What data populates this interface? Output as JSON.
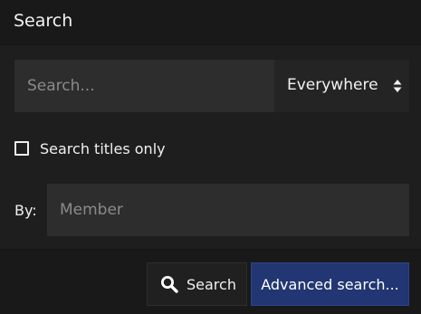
{
  "header": {
    "title": "Search"
  },
  "search": {
    "placeholder": "Search...",
    "value": ""
  },
  "scope": {
    "selected": "Everywhere",
    "icon": "updown-icon"
  },
  "options": {
    "titles_only_label": "Search titles only",
    "titles_only_checked": false
  },
  "by": {
    "label": "By:",
    "placeholder": "Member",
    "value": ""
  },
  "buttons": {
    "search_label": "Search",
    "search_icon": "search-icon",
    "advanced_label": "Advanced search..."
  },
  "colors": {
    "background": "#1e1e1e",
    "header_bg": "#191919",
    "input_bg": "#2d2d2d",
    "primary_button": "#213672"
  }
}
